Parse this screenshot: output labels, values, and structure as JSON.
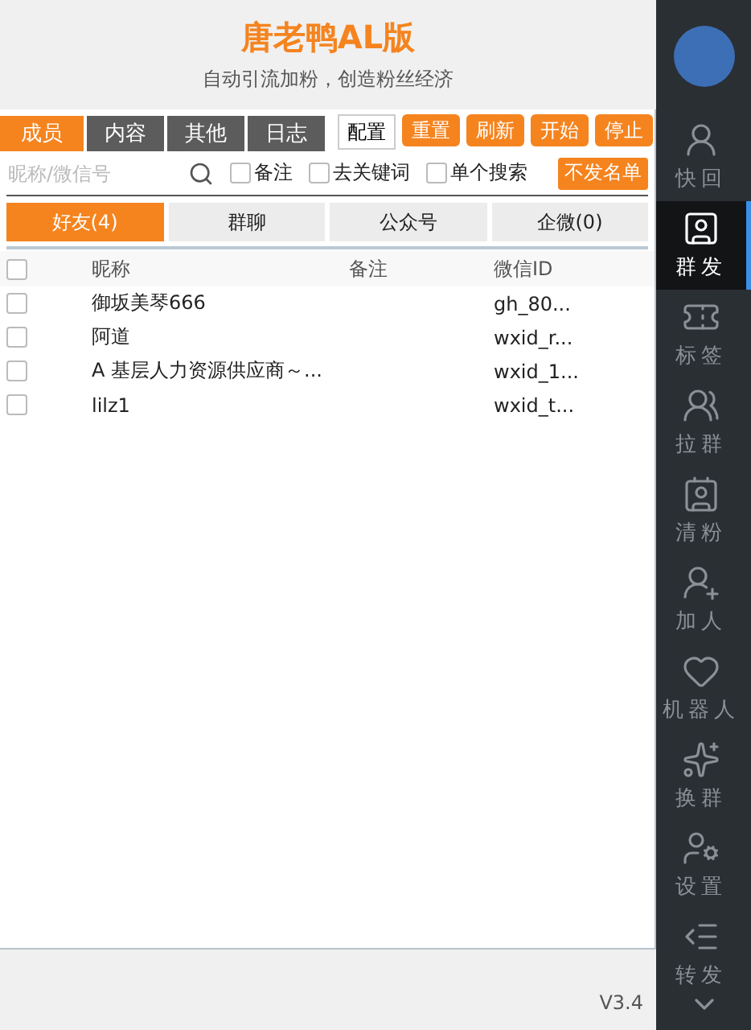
{
  "title": "唐老鸭AL版",
  "subtitle": "自动引流加粉，创造粉丝经济",
  "tabs": [
    {
      "label": "成员",
      "selected": true
    },
    {
      "label": "内容",
      "selected": false
    },
    {
      "label": "其他",
      "selected": false
    },
    {
      "label": "日志",
      "selected": false
    }
  ],
  "config_button": "配置",
  "action_buttons": [
    "重置",
    "刷新",
    "开始",
    "停止"
  ],
  "search": {
    "placeholder": "昵称/微信号"
  },
  "filters": [
    {
      "label": "备注",
      "checked": false
    },
    {
      "label": "去关键词",
      "checked": false
    },
    {
      "label": "单个搜索",
      "checked": false
    }
  ],
  "blacklist_button": "不发名单",
  "categories": [
    {
      "label": "好友(4)",
      "selected": true
    },
    {
      "label": "群聊",
      "selected": false
    },
    {
      "label": "公众号",
      "selected": false
    },
    {
      "label": "企微(0)",
      "selected": false
    }
  ],
  "table": {
    "select_all_checked": false,
    "columns": [
      "昵称",
      "备注",
      "微信ID"
    ],
    "rows": [
      {
        "checked": false,
        "nickname": "御坂美琴666",
        "wechat_id": "gh_80..."
      },
      {
        "checked": false,
        "nickname": "阿道",
        "wechat_id": "wxid_r..."
      },
      {
        "checked": false,
        "nickname": "A 基层人力资源供应商～...",
        "wechat_id": "wxid_1..."
      },
      {
        "checked": false,
        "nickname": "lilz1",
        "wechat_id": "wxid_t..."
      }
    ]
  },
  "version": "V3.4",
  "sidebar": {
    "items": [
      {
        "label": "快回",
        "selected": false
      },
      {
        "label": "群发",
        "selected": true
      },
      {
        "label": "标签",
        "selected": false
      },
      {
        "label": "拉群",
        "selected": false
      },
      {
        "label": "清粉",
        "selected": false
      },
      {
        "label": "加人",
        "selected": false
      },
      {
        "label": "机器人",
        "selected": false
      },
      {
        "label": "换群",
        "selected": false
      },
      {
        "label": "设置",
        "selected": false
      },
      {
        "label": "转发",
        "selected": false
      }
    ]
  }
}
